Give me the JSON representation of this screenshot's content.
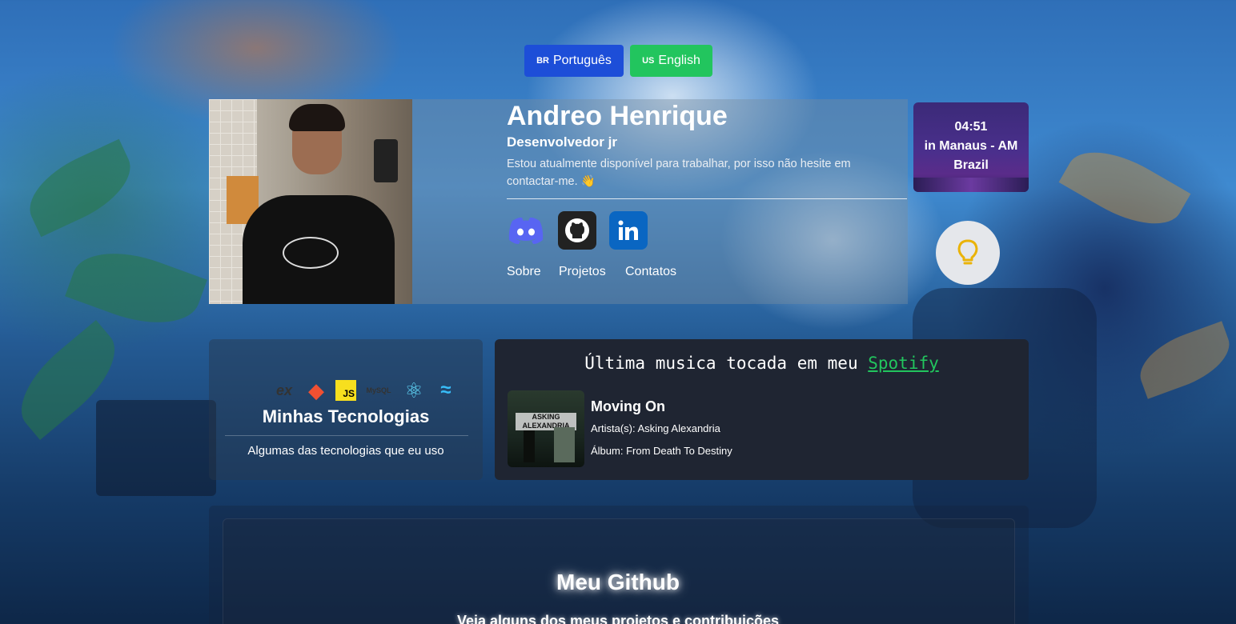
{
  "languages": {
    "pt": {
      "flag": "BR",
      "label": "Português"
    },
    "en": {
      "flag": "US",
      "label": "English"
    }
  },
  "profile": {
    "name": "Andreo Henrique",
    "role": "Desenvolvedor jr",
    "description": "Estou atualmente disponível para trabalhar, por isso não hesite em contactar-me. 👋",
    "social": [
      "discord-icon",
      "github-icon",
      "linkedin-icon"
    ],
    "nav": {
      "about": "Sobre",
      "projects": "Projetos",
      "contacts": "Contatos"
    }
  },
  "clock": {
    "time": "04:51",
    "location": "in Manaus - AM",
    "country": "Brazil"
  },
  "theme_toggle": {
    "icon": "lightbulb-icon",
    "color": "#eab308"
  },
  "technologies": {
    "icons": [
      "express-icon",
      "git-icon",
      "javascript-icon",
      "mysql-icon",
      "react-icon",
      "tailwind-icon"
    ],
    "express_text": "ex",
    "js_text": "JS",
    "mysql_text": "MySQL",
    "title": "Minhas Tecnologias",
    "subtitle": "Algumas das tecnologias que eu uso"
  },
  "spotify": {
    "title_prefix": "Última musica tocada em meu",
    "title_link": "Spotify",
    "cover_text": "ASKING ALEXANDRIA",
    "song": "Moving On",
    "artist": "Artista(s): Asking Alexandria",
    "album": "Álbum: From Death To Destiny"
  },
  "github": {
    "title": "Meu Github",
    "subtitle": "Veja alguns dos meus projetos e contribuições"
  },
  "colors": {
    "brand_blue": "#1d4ed8",
    "brand_green": "#22c55e",
    "spotify_green": "#22c55e"
  }
}
